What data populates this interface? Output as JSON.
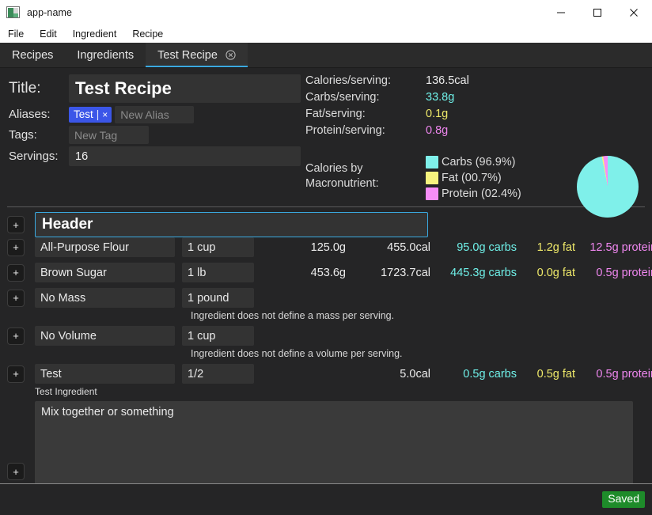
{
  "window": {
    "title": "app-name",
    "app_icon": "app-logo-icon",
    "controls": {
      "minimize": "minimize-icon",
      "maximize": "maximize-icon",
      "close": "close-icon"
    }
  },
  "menubar": {
    "items": [
      {
        "label": "File"
      },
      {
        "label": "Edit"
      },
      {
        "label": "Ingredient"
      },
      {
        "label": "Recipe"
      }
    ]
  },
  "tabs": {
    "items": [
      {
        "label": "Recipes",
        "active": false,
        "closable": false
      },
      {
        "label": "Ingredients",
        "active": false,
        "closable": false
      },
      {
        "label": "Test Recipe",
        "active": true,
        "closable": true
      }
    ],
    "close_icon": "tab-close-icon",
    "active_underline_color": "#3aa9e0"
  },
  "form": {
    "title": {
      "label": "Title:",
      "value": "Test Recipe"
    },
    "aliases": {
      "label": "Aliases:",
      "chips": [
        {
          "text": "Test",
          "separator": "|",
          "remove": "×"
        }
      ],
      "placeholder": "New Alias"
    },
    "tags": {
      "label": "Tags:",
      "placeholder": "New Tag"
    },
    "servings": {
      "label": "Servings:",
      "value": "16"
    }
  },
  "nutrition": {
    "rows": [
      {
        "label": "Calories/serving:",
        "value": "136.5cal",
        "color": "#ececec"
      },
      {
        "label": "Carbs/serving:",
        "value": "33.8g",
        "color": "#6ff0e8"
      },
      {
        "label": "Fat/serving:",
        "value": "0.1g",
        "color": "#efe96a"
      },
      {
        "label": "Protein/serving:",
        "value": "0.8g",
        "color": "#ef87ef"
      }
    ],
    "macro_label_line1": "Calories by",
    "macro_label_line2": "Macronutrient:",
    "legend": [
      {
        "text": "Carbs (96.9%)",
        "color": "#7ff0ea"
      },
      {
        "text": "Fat (00.7%)",
        "color": "#f7f47e"
      },
      {
        "text": "Protein (02.4%)",
        "color": "#f78df7"
      }
    ]
  },
  "chart_data": {
    "type": "pie",
    "title": "Calories by Macronutrient",
    "labels": [
      "Carbs",
      "Fat",
      "Protein"
    ],
    "values": [
      96.9,
      0.7,
      2.4
    ],
    "value_labels": [
      "Carbs (96.9%)",
      "Fat (00.7%)",
      "Protein (02.4%)"
    ],
    "colors": [
      "#7ff0ea",
      "#f7f47e",
      "#f78df7"
    ],
    "units": "percent",
    "legend_position": "left",
    "start_angle_deg": 0
  },
  "ingredient_section": {
    "add_button_label": "+",
    "header_row": {
      "value": "Header"
    },
    "rows": [
      {
        "name": "All-Purpose Flour",
        "amount": "1 cup",
        "mass": "125.0g",
        "calories": "455.0cal",
        "carbs": "95.0g carbs",
        "fat": "1.2g fat",
        "protein": "12.5g protein",
        "warning": "",
        "note": ""
      },
      {
        "name": "Brown Sugar",
        "amount": "1 lb",
        "mass": "453.6g",
        "calories": "1723.7cal",
        "carbs": "445.3g carbs",
        "fat": "0.0g fat",
        "protein": "0.5g protein",
        "warning": "",
        "note": ""
      },
      {
        "name": "No Mass",
        "amount": "1 pound",
        "mass": "",
        "calories": "",
        "carbs": "",
        "fat": "",
        "protein": "",
        "warning": "Ingredient does not define a mass per serving.",
        "note": ""
      },
      {
        "name": "No Volume",
        "amount": "1 cup",
        "mass": "",
        "calories": "",
        "carbs": "",
        "fat": "",
        "protein": "",
        "warning": "Ingredient does not define a volume per serving.",
        "note": ""
      },
      {
        "name": "Test",
        "amount": "1/2",
        "mass": "",
        "calories": "5.0cal",
        "carbs": "0.5g carbs",
        "fat": "0.5g fat",
        "protein": "0.5g protein",
        "warning": "",
        "note": "Test Ingredient"
      }
    ],
    "instructions": "Mix together or something"
  },
  "statusbar": {
    "save_status": "Saved",
    "save_status_color": "#1e8b2a"
  },
  "colors": {
    "carbs": "#6ff0e8",
    "fat": "#efe96a",
    "protein": "#ef87ef",
    "accent": "#3aa9e0",
    "chip": "#3b56e8",
    "background": "#252526"
  }
}
